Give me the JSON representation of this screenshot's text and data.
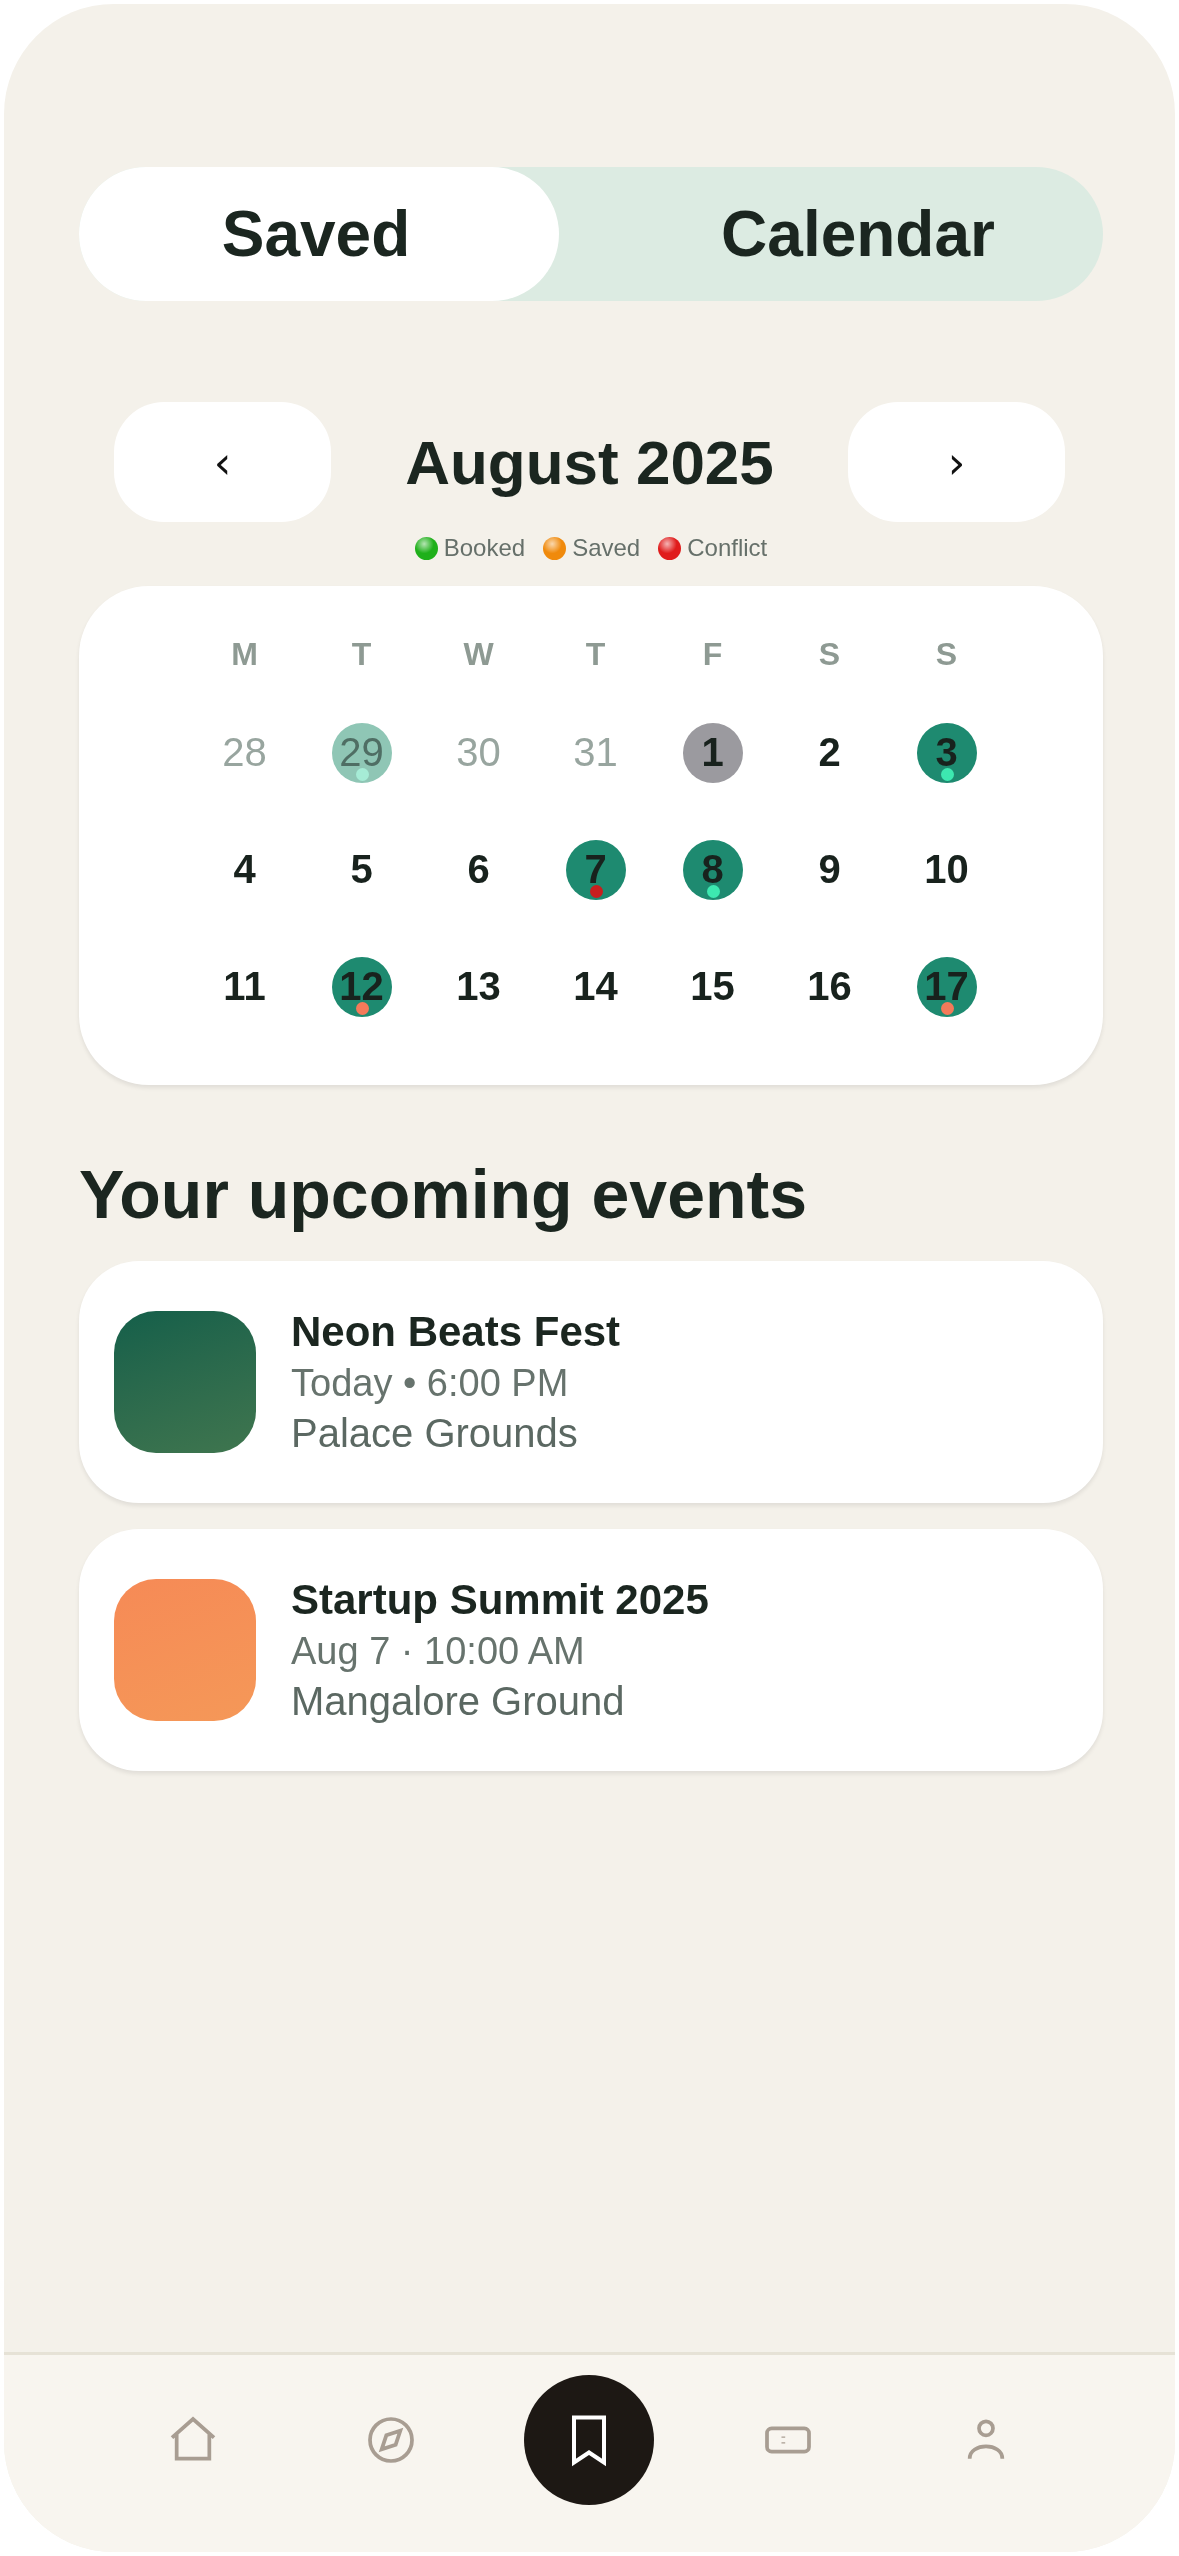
{
  "tabs": [
    {
      "label": "Saved",
      "selected": true
    },
    {
      "label": "Calendar",
      "selected": false
    }
  ],
  "month": {
    "prev": "‹",
    "title": "August 2025",
    "next": "›"
  },
  "legend": [
    {
      "label": "Booked",
      "color": "#1fb01a"
    },
    {
      "label": "Saved",
      "color": "#f08a0c"
    },
    {
      "label": "Conflict",
      "color": "#e01c1c"
    }
  ],
  "weekdays": [
    "M",
    "T",
    "W",
    "T",
    "F",
    "S",
    "S"
  ],
  "days": [
    {
      "label": "28",
      "muted": true
    },
    {
      "label": "29",
      "muted": true,
      "color": "#8fc6b5",
      "dot": {
        "color": "#a6ecd6"
      }
    },
    {
      "label": "30",
      "muted": true
    },
    {
      "label": "31",
      "muted": true
    },
    {
      "label": "1",
      "muted": false,
      "color": "#9b9a9f"
    },
    {
      "label": "2",
      "muted": false
    },
    {
      "label": "3",
      "muted": false,
      "color": "#1e8a70",
      "dot": {
        "color": "#3de8b0"
      }
    },
    {
      "label": "4",
      "muted": false
    },
    {
      "label": "5",
      "muted": false
    },
    {
      "label": "6",
      "muted": false
    },
    {
      "label": "7",
      "muted": false,
      "color": "#1e8a70",
      "dot": {
        "color": "#c81e1e"
      }
    },
    {
      "label": "8",
      "muted": false,
      "color": "#1e8a70",
      "dot": {
        "color": "#3de8b0"
      }
    },
    {
      "label": "9",
      "muted": false
    },
    {
      "label": "10",
      "muted": false
    },
    {
      "label": "11",
      "muted": false
    },
    {
      "label": "12",
      "muted": false,
      "color": "#1e8a70",
      "dot": {
        "color": "#f47a5a"
      }
    },
    {
      "label": "13",
      "muted": false
    },
    {
      "label": "14",
      "muted": false
    },
    {
      "label": "15",
      "muted": false
    },
    {
      "label": "16",
      "muted": false
    },
    {
      "label": "17",
      "muted": false,
      "color": "#1e8a70",
      "dot": {
        "color": "#f47a5a"
      }
    }
  ],
  "events_heading": "Your upcoming events",
  "events": [
    {
      "title": "Neon Beats Fest",
      "when": "Today • 6:00 PM",
      "place": "Palace Grounds",
      "color": "#135f4a"
    },
    {
      "title": "Startup Summit 2025",
      "when": "Aug 7 · 10:00 AM",
      "place": "Mangalore Ground",
      "color": "#f68a56"
    }
  ],
  "nav": [
    {
      "kind": "home",
      "selected": false
    },
    {
      "kind": "compass",
      "selected": false
    },
    {
      "kind": "bookmark",
      "selected": true
    },
    {
      "kind": "ticket",
      "selected": false
    },
    {
      "kind": "profile",
      "selected": false
    }
  ]
}
